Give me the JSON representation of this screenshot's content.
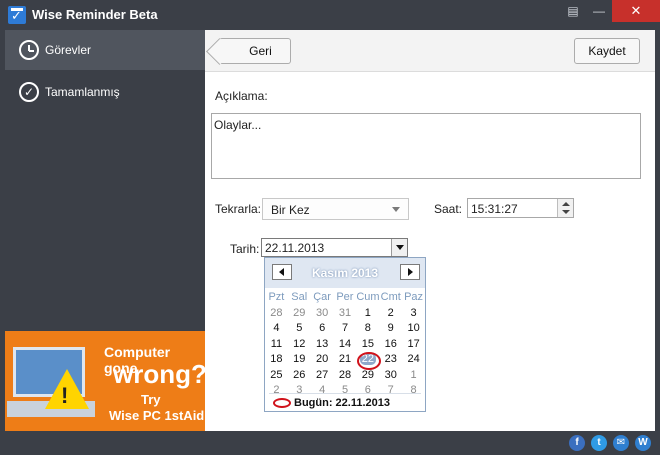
{
  "window": {
    "title": "Wise Reminder Beta"
  },
  "sidebar": {
    "items": [
      {
        "label": "Görevler",
        "icon": "clock-icon",
        "active": true
      },
      {
        "label": "Tamamlanmış",
        "icon": "check-circle-icon",
        "active": false
      }
    ],
    "ad": {
      "line1": "Computer gone",
      "line2": "wrong?",
      "line3": "Try",
      "line4": "Wise PC 1stAid"
    }
  },
  "toolbar": {
    "back_label": "Geri",
    "save_label": "Kaydet"
  },
  "form": {
    "description_label": "Açıklama:",
    "description_value": "Olaylar...",
    "repeat_label": "Tekrarla:",
    "repeat_value": "Bir Kez",
    "time_label": "Saat:",
    "time_value": "15:31:27",
    "date_label": "Tarih:",
    "date_value": "22.11.2013"
  },
  "calendar": {
    "month_title": "Kasım 2013",
    "weekdays": [
      "Pzt",
      "Sal",
      "Çar",
      "Per",
      "Cum",
      "Cmt",
      "Paz"
    ],
    "weeks": [
      [
        "28",
        "29",
        "30",
        "31",
        "1",
        "2",
        "3"
      ],
      [
        "4",
        "5",
        "6",
        "7",
        "8",
        "9",
        "10"
      ],
      [
        "11",
        "12",
        "13",
        "14",
        "15",
        "16",
        "17"
      ],
      [
        "18",
        "19",
        "20",
        "21",
        "22",
        "23",
        "24"
      ],
      [
        "25",
        "26",
        "27",
        "28",
        "29",
        "30",
        "1"
      ],
      [
        "2",
        "3",
        "4",
        "5",
        "6",
        "7",
        "8"
      ]
    ],
    "today_label": "Bugün: 22.11.2013"
  },
  "colors": {
    "sidebar_bg": "#3b3f47",
    "close_red": "#c7302b",
    "ad_orange": "#ee7d17",
    "today_ring": "#d0121b"
  }
}
